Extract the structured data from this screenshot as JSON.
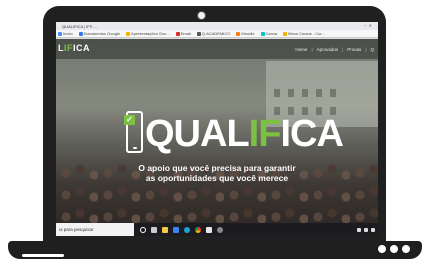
{
  "browser": {
    "tab_title": "QUALIFICA | IFF-...",
    "bookmarks": [
      {
        "label": "Início",
        "color": "#4a8cf7"
      },
      {
        "label": "Documentos Google",
        "color": "#3b78e7"
      },
      {
        "label": "Apresentações Goo...",
        "color": "#f4b400"
      },
      {
        "label": "Email",
        "color": "#d93025"
      },
      {
        "label": "Q-ACADEMICO",
        "color": "#555555"
      },
      {
        "label": "Moodle",
        "color": "#f98012"
      },
      {
        "label": "Canva",
        "color": "#00c4cc"
      },
      {
        "label": "Meus Cursos - Cur...",
        "color": "#f4b400"
      }
    ]
  },
  "site": {
    "logo_prefix": "QUAL",
    "logo_highlight": "IF",
    "logo_suffix": "ICA",
    "small_logo_prefix": "L",
    "small_logo_highlight": "IF",
    "small_logo_suffix": "ICA",
    "nav": [
      "Home",
      "Aprovados",
      "Provas",
      "Q"
    ],
    "tagline_line1": "O apoio que você precisa para garantir",
    "tagline_line2": "as oportunidades que você merece",
    "accent_color": "#7cc142"
  },
  "taskbar": {
    "search_placeholder": "ui para pesquisar",
    "icons": [
      "start-icon",
      "search-icon",
      "task-view-icon",
      "file-explorer-icon",
      "store-icon",
      "edge-icon",
      "chrome-icon",
      "mail-icon",
      "settings-icon"
    ]
  }
}
